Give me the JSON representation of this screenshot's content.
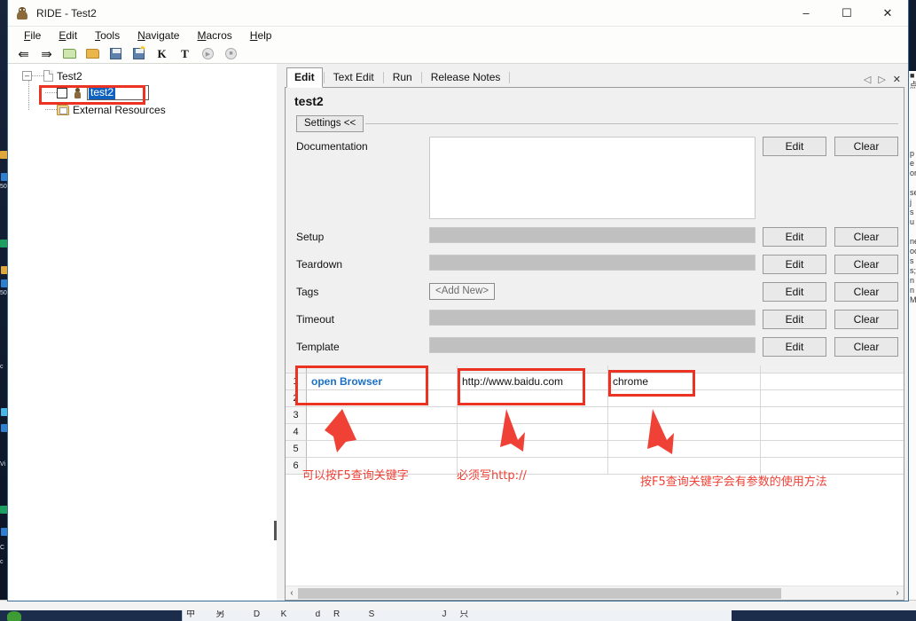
{
  "window": {
    "title": "RIDE - Test2",
    "app_icon": "robot-icon",
    "buttons": {
      "minimize": "–",
      "maximize": "☐",
      "close": "✕"
    }
  },
  "menubar": {
    "items": [
      {
        "label": "File",
        "accel": "F"
      },
      {
        "label": "Edit",
        "accel": "E"
      },
      {
        "label": "Tools",
        "accel": "T"
      },
      {
        "label": "Navigate",
        "accel": "N"
      },
      {
        "label": "Macros",
        "accel": "M"
      },
      {
        "label": "Help",
        "accel": "H"
      }
    ]
  },
  "toolbar": {
    "items": [
      {
        "name": "back-arrow-icon",
        "glyph": "⇦"
      },
      {
        "name": "forward-arrow-icon",
        "glyph": "⇨"
      },
      {
        "name": "open-test-suite-icon",
        "glyph": ""
      },
      {
        "name": "open-directory-icon",
        "glyph": ""
      },
      {
        "name": "save-icon",
        "glyph": ""
      },
      {
        "name": "save-all-icon",
        "glyph": ""
      },
      {
        "name": "search-keyword-icon",
        "glyph": "K"
      },
      {
        "name": "search-tests-icon",
        "glyph": "T"
      },
      {
        "name": "run-icon",
        "glyph": "▶"
      },
      {
        "name": "stop-icon",
        "glyph": "■"
      }
    ]
  },
  "tree": {
    "root": {
      "label": "Test2",
      "expander": "–",
      "icon": "document-icon"
    },
    "child": {
      "label": "test2",
      "icon": "robot-test-icon",
      "checkbox": false,
      "selected": true,
      "editing": true
    },
    "external": {
      "label": "External Resources",
      "icon": "resource-folder-icon"
    }
  },
  "notebook": {
    "tabs": [
      {
        "label": "Edit",
        "active": true
      },
      {
        "label": "Text Edit",
        "active": false
      },
      {
        "label": "Run",
        "active": false
      },
      {
        "label": "Release Notes",
        "active": false
      }
    ],
    "nav": {
      "prev": "◁",
      "next": "▷",
      "close": "✕"
    }
  },
  "page": {
    "title": "test2",
    "settings_toggle": "Settings <<",
    "rows": [
      {
        "label": "Documentation",
        "type": "textarea",
        "value": "",
        "edit": "Edit",
        "clear": "Clear"
      },
      {
        "label": "Setup",
        "type": "disabled-field",
        "value": "",
        "edit": "Edit",
        "clear": "Clear"
      },
      {
        "label": "Teardown",
        "type": "disabled-field",
        "value": "",
        "edit": "Edit",
        "clear": "Clear"
      },
      {
        "label": "Tags",
        "type": "add-new",
        "value": "<Add New>",
        "edit": "Edit",
        "clear": "Clear"
      },
      {
        "label": "Timeout",
        "type": "disabled-field",
        "value": "",
        "edit": "Edit",
        "clear": "Clear"
      },
      {
        "label": "Template",
        "type": "disabled-field",
        "value": "",
        "edit": "Edit",
        "clear": "Clear"
      }
    ]
  },
  "grid": {
    "row_numbers": [
      "1",
      "2",
      "3",
      "4",
      "5",
      "6"
    ],
    "cells": {
      "row1": [
        "open Browser",
        "http://www.baidu.com",
        "chrome",
        ""
      ],
      "row2": [
        "",
        "",
        "",
        ""
      ],
      "row3": [
        "",
        "",
        "",
        ""
      ],
      "row4": [
        "",
        "",
        "",
        ""
      ],
      "row5": [
        "",
        "",
        "",
        ""
      ],
      "row6": [
        "",
        "",
        "",
        ""
      ]
    },
    "keyword_color": "#1a70c8",
    "scrollbar": {
      "left": "‹",
      "right": "›"
    }
  },
  "annotations": {
    "color": "#ef4136",
    "boxes": [
      {
        "name": "tree-item-highlight"
      },
      {
        "name": "keyword-cell-highlight"
      },
      {
        "name": "url-cell-highlight"
      },
      {
        "name": "browser-cell-highlight"
      }
    ],
    "notes": [
      {
        "text": "可以按F5查询关键字"
      },
      {
        "text": "必须写http://"
      },
      {
        "text": "按F5查询关键字会有参数的使用方法"
      }
    ]
  },
  "desktop": {
    "icon_labels": [
      "50",
      "50",
      "c",
      "Vi",
      "C",
      "c"
    ],
    "right_peek_lines": [
      "■",
      "浏",
      "",
      "p",
      "e",
      "or",
      "se",
      "j",
      "s",
      "u",
      "",
      "ne",
      "oc",
      "s",
      "s;",
      "n",
      "n",
      "M"
    ]
  }
}
